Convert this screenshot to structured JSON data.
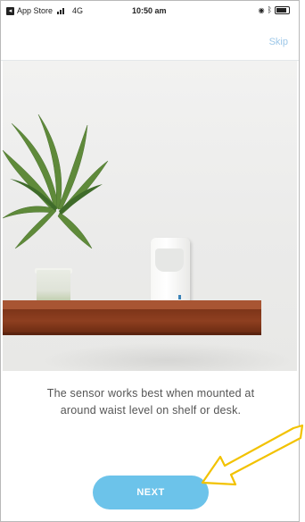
{
  "status_bar": {
    "carrier": "App Store",
    "network": "4G",
    "time": "10:50 am"
  },
  "header": {
    "skip_label": "Skip"
  },
  "illustration": {
    "subject": "motion sensor on shelf with potted plant"
  },
  "main": {
    "description": "The sensor works best when mounted at around waist level on shelf or desk.",
    "next_label": "NEXT"
  },
  "colors": {
    "accent": "#6cc3ea",
    "skip_link": "#9cc7e8",
    "annotation_arrow": "#f2c200",
    "shelf": "#8e3f20"
  }
}
